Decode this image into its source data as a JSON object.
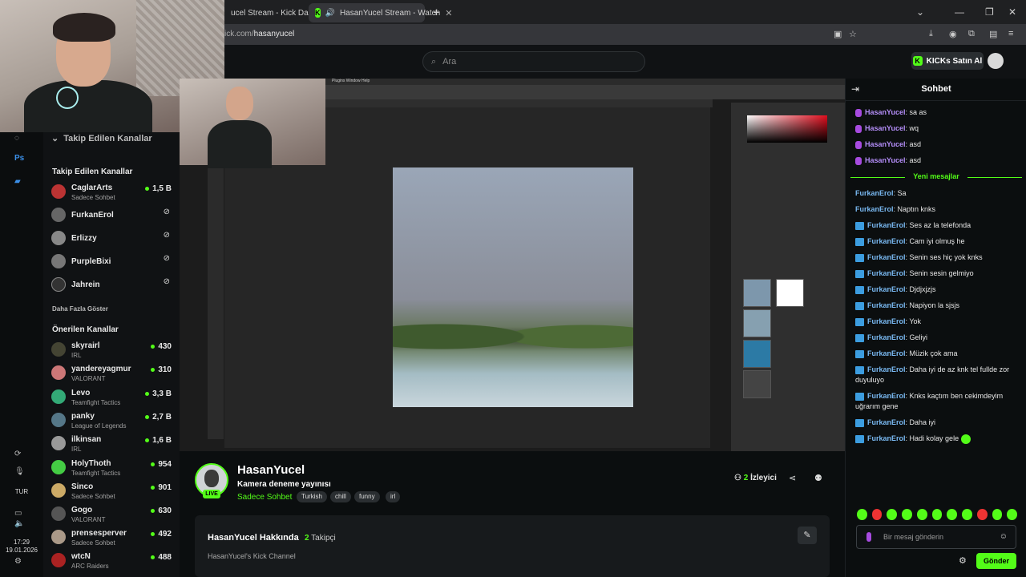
{
  "browser": {
    "tabs": [
      {
        "title": "ucel Stream - Kick Dashb"
      },
      {
        "title": "HasanYucel Stream - Watch"
      }
    ],
    "url_prefix": "ick.com/",
    "url_path": "hasanyucel",
    "new_tab": "+"
  },
  "header": {
    "search_placeholder": "Ara",
    "kicks_button": "KICKs Satın Al"
  },
  "sidebar": {
    "followed_header_partial": "Takip Edilen Kanallar",
    "followed_header": "Takip Edilen Kanallar",
    "followed": [
      {
        "name": "CaglarArts",
        "sub": "Sadece Sohbet",
        "viewers": "1,5 B",
        "color": "#b33"
      },
      {
        "name": "FurkanErol",
        "sub": "",
        "viewers": "",
        "color": "#666"
      },
      {
        "name": "Erlizzy",
        "sub": "",
        "viewers": "",
        "color": "#888"
      },
      {
        "name": "PurpleBixi",
        "sub": "",
        "viewers": "",
        "color": "#777"
      },
      {
        "name": "Jahrein",
        "sub": "",
        "viewers": "",
        "color": "#333"
      }
    ],
    "show_more": "Daha Fazla Göster",
    "recommended_header": "Önerilen Kanallar",
    "recommended": [
      {
        "name": "skyrairl",
        "sub": "IRL",
        "viewers": "430",
        "color": "#443"
      },
      {
        "name": "yandereyagmur",
        "sub": "VALORANT",
        "viewers": "310",
        "color": "#c77"
      },
      {
        "name": "Levo",
        "sub": "Teamfight Tactics",
        "viewers": "3,3 B",
        "color": "#3a7"
      },
      {
        "name": "panky",
        "sub": "League of Legends",
        "viewers": "2,7 B",
        "color": "#578"
      },
      {
        "name": "ilkinsan",
        "sub": "IRL",
        "viewers": "1,6 B",
        "color": "#999"
      },
      {
        "name": "HolyThoth",
        "sub": "Teamfight Tactics",
        "viewers": "954",
        "color": "#4c4"
      },
      {
        "name": "Sinco",
        "sub": "Sadece Sohbet",
        "viewers": "901",
        "color": "#ca6"
      },
      {
        "name": "Gogo",
        "sub": "VALORANT",
        "viewers": "630",
        "color": "#555"
      },
      {
        "name": "prensesperver",
        "sub": "Sadece Sohbet",
        "viewers": "492",
        "color": "#a98"
      },
      {
        "name": "wtcN",
        "sub": "ARC Raiders",
        "viewers": "488",
        "color": "#a22"
      }
    ]
  },
  "taskbar": {
    "lang": "TUR",
    "time": "17:29",
    "date": "19.01.2026"
  },
  "stream": {
    "streamer": "HasanYucel",
    "title": "Kamera deneme yayınısı",
    "category": "Sadece Sohbet",
    "live": "LIVE",
    "tags": [
      "Turkish",
      "chill",
      "funny",
      "irl"
    ],
    "viewer_count": "2",
    "viewer_label": "İzleyici",
    "about_title": "HasanYucel Hakkında",
    "followers_count": "2",
    "followers_label": "Takipçi",
    "about_desc": "HasanYucel's Kick Channel",
    "ps_menu": "Plugins  Window  Help"
  },
  "chat": {
    "title": "Sohbet",
    "old_messages": [
      {
        "user": "HasanYucel",
        "text": "sa as"
      },
      {
        "user": "HasanYucel",
        "text": "wq"
      },
      {
        "user": "HasanYucel",
        "text": "asd"
      },
      {
        "user": "HasanYucel",
        "text": "asd"
      }
    ],
    "new_divider": "Yeni mesajlar",
    "new_messages": [
      {
        "user": "FurkanErol",
        "text": "Sa",
        "badge": false
      },
      {
        "user": "FurkanErol",
        "text": "Naptın knks",
        "badge": false
      },
      {
        "user": "FurkanErol",
        "text": "Ses az la telefonda",
        "badge": true
      },
      {
        "user": "FurkanErol",
        "text": "Cam iyi olmuş he",
        "badge": true
      },
      {
        "user": "FurkanErol",
        "text": "Senin ses hiç yok knks",
        "badge": true
      },
      {
        "user": "FurkanErol",
        "text": "Senin sesin gelmiyo",
        "badge": true
      },
      {
        "user": "FurkanErol",
        "text": "Djdjxjzjs",
        "badge": true
      },
      {
        "user": "FurkanErol",
        "text": "Napiyon la sjsjs",
        "badge": true
      },
      {
        "user": "FurkanErol",
        "text": "Yok",
        "badge": true
      },
      {
        "user": "FurkanErol",
        "text": "Geliyi",
        "badge": true
      },
      {
        "user": "FurkanErol",
        "text": "Müzik çok ama",
        "badge": true
      },
      {
        "user": "FurkanErol",
        "text": "Daha iyi de az knk tel fullde zor duyuluyo",
        "badge": true
      },
      {
        "user": "FurkanErol",
        "text": "Knks kaçtım ben cekimdeyim uğrarım gene",
        "badge": true
      },
      {
        "user": "FurkanErol",
        "text": "Daha iyi",
        "badge": true
      },
      {
        "user": "FurkanErol",
        "text": "Hadi kolay gele",
        "badge": true
      }
    ],
    "input_placeholder": "Bir mesaj gönderin",
    "send_label": "Gönder"
  },
  "colors": {
    "accent": "#53fc18",
    "chat_user_purple": "#b38df7",
    "chat_user_blue": "#79b9f2"
  }
}
